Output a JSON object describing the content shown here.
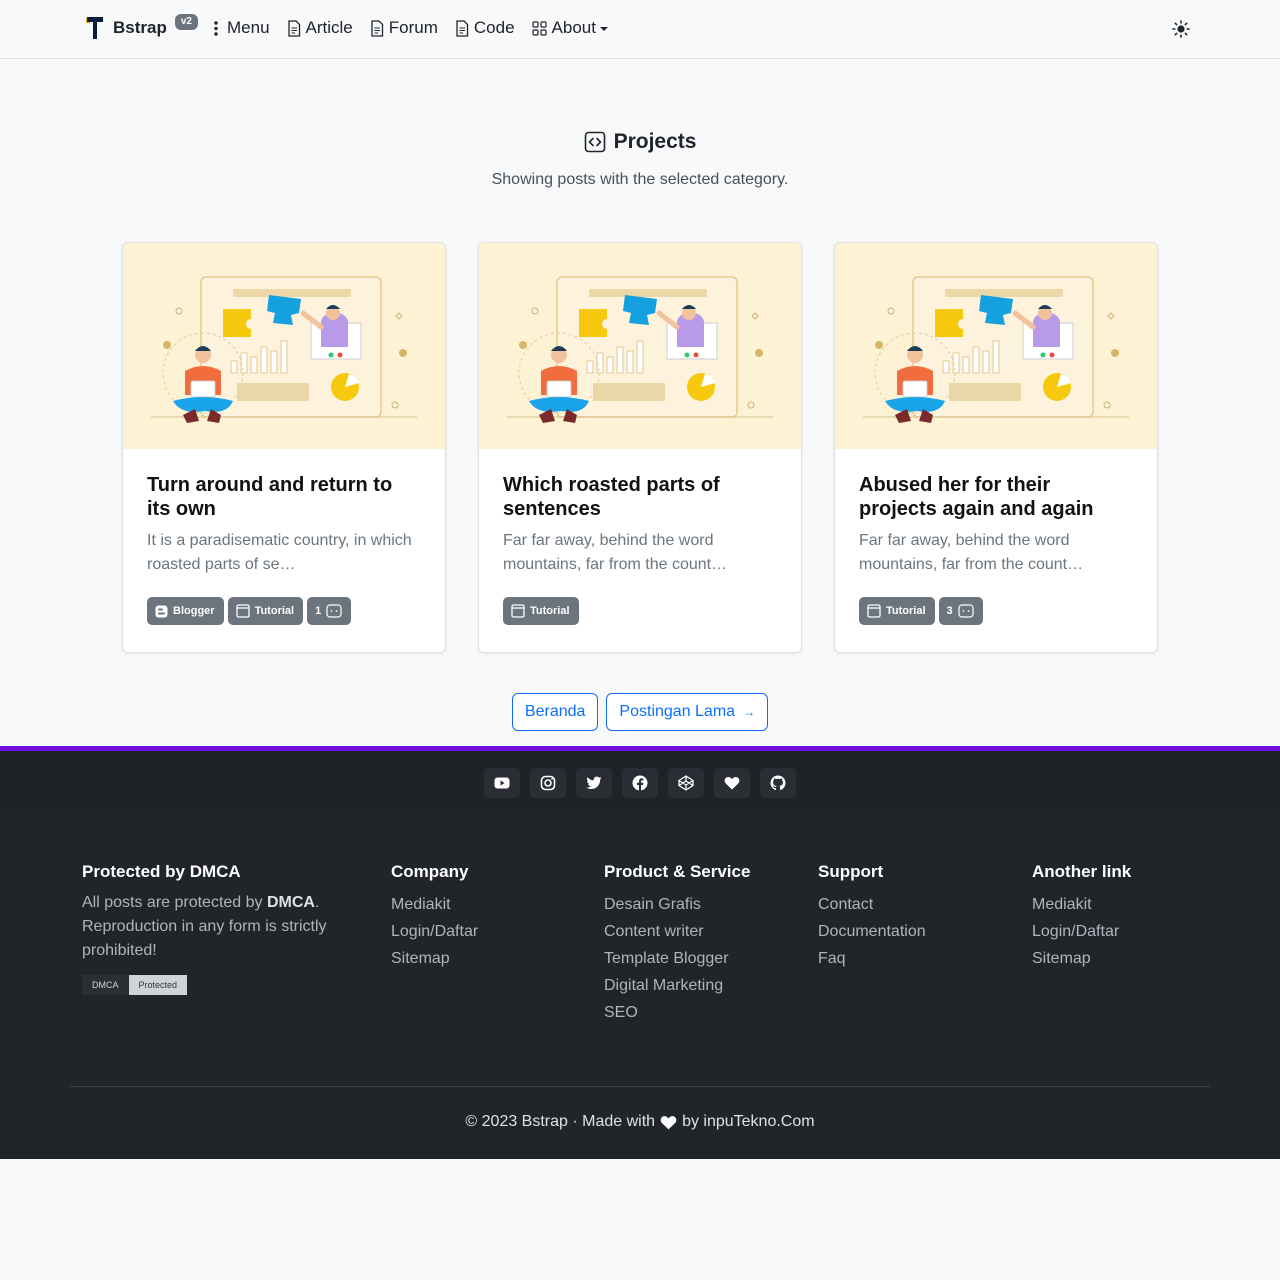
{
  "navbar": {
    "brand": "Bstrap",
    "badge": "v2",
    "items": [
      {
        "label": "Menu",
        "icon": "dots-vertical-icon"
      },
      {
        "label": "Article",
        "icon": "document-icon"
      },
      {
        "label": "Forum",
        "icon": "document-icon"
      },
      {
        "label": "Code",
        "icon": "document-icon"
      },
      {
        "label": "About",
        "icon": "grid-icon"
      }
    ],
    "theme_icon": "sun-icon"
  },
  "header": {
    "title": "Projects",
    "subtitle": "Showing posts with the selected category."
  },
  "posts": [
    {
      "title": "Turn around and return to its own",
      "excerpt": "It is a paradisematic country, in which roasted parts of se…",
      "tags": [
        "Blogger",
        "Tutorial"
      ],
      "comments": "1"
    },
    {
      "title": "Which roasted parts of sentences",
      "excerpt": "Far far away, behind the word mountains, far from the count…",
      "tags": [
        "Tutorial"
      ],
      "comments": ""
    },
    {
      "title": "Abused her for their projects again and again",
      "excerpt": "Far far away, behind the word mountains, far from the count…",
      "tags": [
        "Tutorial"
      ],
      "comments": "3"
    }
  ],
  "pager": {
    "home": "Beranda",
    "older": "Postingan Lama",
    "older_arrow": "→"
  },
  "social": [
    "youtube-icon",
    "instagram-icon",
    "twitter-icon",
    "facebook-icon",
    "codepen-icon",
    "heart-icon",
    "github-icon"
  ],
  "footer": {
    "dmca": {
      "title": "Protected by DMCA",
      "text_before": "All posts are protected by ",
      "text_bold": "DMCA",
      "text_after": ". Reproduction in any form is strictly prohibited!",
      "badge_left": "DMCA",
      "badge_right": "Protected"
    },
    "company": {
      "title": "Company",
      "links": [
        "Mediakit",
        "Login/Daftar",
        "Sitemap"
      ]
    },
    "product": {
      "title": "Product & Service",
      "links": [
        "Desain Grafis",
        "Content writer",
        "Template Blogger",
        "Digital Marketing",
        "SEO"
      ]
    },
    "support": {
      "title": "Support",
      "links": [
        "Contact",
        "Documentation",
        "Faq"
      ]
    },
    "another": {
      "title": "Another link",
      "links": [
        "Mediakit",
        "Login/Daftar",
        "Sitemap"
      ]
    },
    "copyright_left": "© 2023 Bstrap · Made with",
    "copyright_right": "by inpuTekno.Com"
  },
  "colors": {
    "accent": "#0d6efd",
    "footer_accent": "#6f0fe0",
    "tag_bg": "#6c757d",
    "card_image_bg": "#fef2d4"
  }
}
